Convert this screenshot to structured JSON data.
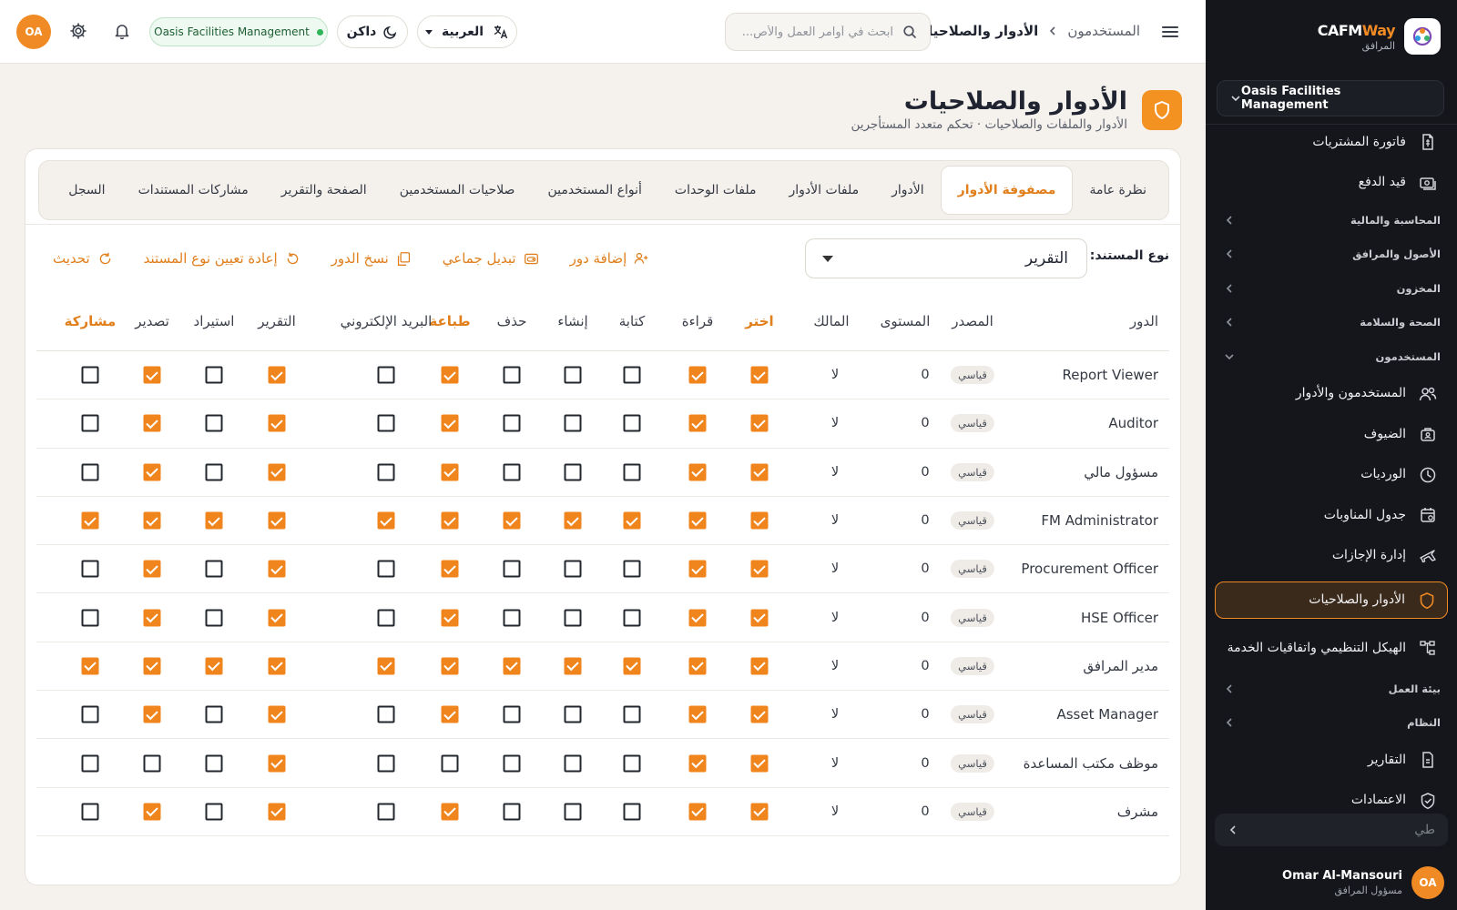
{
  "sidebar": {
    "brand": {
      "name_main": "CAFM",
      "name_accent": "Way",
      "subtitle": "المرافق"
    },
    "org_selector": "Oasis Facilities Management",
    "items": [
      {
        "type": "item",
        "label": "فاتورة المشتريات",
        "icon": "invoice-icon"
      },
      {
        "type": "item",
        "label": "قيد الدفع",
        "icon": "payment-icon"
      },
      {
        "type": "group",
        "label": "المحاسبة والمالية",
        "expanded": false
      },
      {
        "type": "group",
        "label": "الأصول والمرافق",
        "expanded": false
      },
      {
        "type": "group",
        "label": "المخزون",
        "expanded": false
      },
      {
        "type": "group",
        "label": "الصحة والسلامة",
        "expanded": false
      },
      {
        "type": "group",
        "label": "المستخدمون",
        "expanded": true
      },
      {
        "type": "item",
        "label": "المستخدمون والأدوار",
        "icon": "users-icon"
      },
      {
        "type": "item",
        "label": "الضيوف",
        "icon": "guests-icon"
      },
      {
        "type": "item",
        "label": "الورديات",
        "icon": "clock-icon"
      },
      {
        "type": "item",
        "label": "جدول المناوبات",
        "icon": "calendar-icon"
      },
      {
        "type": "item",
        "label": "إدارة الإجازات",
        "icon": "plane-icon"
      },
      {
        "type": "item",
        "label": "الأدوار والصلاحيات",
        "icon": "shield-icon",
        "active": true
      },
      {
        "type": "item",
        "label": "الهيكل التنظيمي واتفاقيات الخدمة",
        "icon": "org-chart-icon"
      },
      {
        "type": "group",
        "label": "بيئة العمل",
        "expanded": false
      },
      {
        "type": "group",
        "label": "النظام",
        "expanded": false
      },
      {
        "type": "item",
        "label": "التقارير",
        "icon": "reports-icon"
      },
      {
        "type": "item",
        "label": "الاعتمادات",
        "icon": "approvals-icon"
      }
    ],
    "collapse_label": "طي",
    "user": {
      "initials": "OA",
      "name": "Omar Al-Mansouri",
      "role": "مسؤول المرافق"
    }
  },
  "topbar": {
    "breadcrumb_parent": "المستخدمون",
    "breadcrumb_current": "الأدوار والصلاحيات",
    "search_placeholder": "ابحث في أوامر العمل والأص...",
    "language": "العربية",
    "theme": "داكن",
    "org_status": "Oasis Facilities Management",
    "avatar_initials": "OA"
  },
  "page": {
    "title": "الأدوار والصلاحيات",
    "subtitle": "الأدوار والملفات والصلاحيات · تحكم متعدد المستأجرين"
  },
  "tabs": [
    {
      "label": "نظرة عامة",
      "active": false
    },
    {
      "label": "مصفوفة الأدوار",
      "active": true
    },
    {
      "label": "الأدوار",
      "active": false
    },
    {
      "label": "ملفات الأدوار",
      "active": false
    },
    {
      "label": "ملفات الوحدات",
      "active": false
    },
    {
      "label": "أنواع المستخدمين",
      "active": false
    },
    {
      "label": "صلاحيات المستخدمين",
      "active": false
    },
    {
      "label": "الصفحة والتقرير",
      "active": false
    },
    {
      "label": "مشاركات المستندات",
      "active": false
    },
    {
      "label": "السجل",
      "active": false
    }
  ],
  "toolbar": {
    "doc_type_label": "نوع المستند:",
    "doc_type_value": "التقرير",
    "actions": [
      {
        "label": "إضافة دور",
        "icon": "add-user-icon"
      },
      {
        "label": "تبديل جماعي",
        "icon": "bulk-toggle-icon"
      },
      {
        "label": "نسخ الدور",
        "icon": "copy-icon"
      },
      {
        "label": "إعادة تعيين نوع المستند",
        "icon": "reset-icon"
      },
      {
        "label": "تحديث",
        "icon": "refresh-icon"
      }
    ]
  },
  "matrix": {
    "columns": [
      "الدور",
      "المصدر",
      "المستوى",
      "المالك",
      "اختر",
      "قراءة",
      "كتابة",
      "إنشاء",
      "حذف",
      "طباعة",
      "البريد الإلكتروني",
      "التقرير",
      "استيراد",
      "تصدير",
      "مشاركة"
    ],
    "highlighted_columns": [
      "اختر",
      "طباعة",
      "مشاركة"
    ],
    "source_badge": "قياسي",
    "owner_value": "لا",
    "rows": [
      {
        "role": "Report Viewer",
        "level": "0",
        "perms": [
          1,
          1,
          0,
          0,
          0,
          1,
          0,
          1,
          0,
          1,
          0
        ]
      },
      {
        "role": "Auditor",
        "level": "0",
        "perms": [
          1,
          1,
          0,
          0,
          0,
          1,
          0,
          1,
          0,
          1,
          0
        ]
      },
      {
        "role": "مسؤول مالي",
        "level": "0",
        "perms": [
          1,
          1,
          0,
          0,
          0,
          1,
          0,
          1,
          0,
          1,
          0
        ]
      },
      {
        "role": "FM Administrator",
        "level": "0",
        "perms": [
          1,
          1,
          1,
          1,
          1,
          1,
          1,
          1,
          1,
          1,
          1
        ]
      },
      {
        "role": "Procurement Officer",
        "level": "0",
        "perms": [
          1,
          1,
          0,
          0,
          0,
          1,
          0,
          1,
          0,
          1,
          0
        ]
      },
      {
        "role": "HSE Officer",
        "level": "0",
        "perms": [
          1,
          1,
          0,
          0,
          0,
          1,
          0,
          1,
          0,
          1,
          0
        ]
      },
      {
        "role": "مدير المرافق",
        "level": "0",
        "perms": [
          1,
          1,
          1,
          1,
          1,
          1,
          1,
          1,
          1,
          1,
          1
        ]
      },
      {
        "role": "Asset Manager",
        "level": "0",
        "perms": [
          1,
          1,
          0,
          0,
          0,
          1,
          0,
          1,
          0,
          1,
          0
        ]
      },
      {
        "role": "موظف مكتب المساعدة",
        "level": "0",
        "perms": [
          1,
          1,
          0,
          0,
          0,
          0,
          0,
          1,
          0,
          0,
          0
        ]
      },
      {
        "role": "مشرف",
        "level": "0",
        "perms": [
          1,
          1,
          0,
          0,
          0,
          1,
          0,
          1,
          0,
          1,
          0
        ]
      }
    ]
  },
  "colors": {
    "accent": "#f08a24",
    "sidebar_bg": "#14161c",
    "page_bg": "#f5f2ee",
    "status_green": "#2fb457"
  }
}
